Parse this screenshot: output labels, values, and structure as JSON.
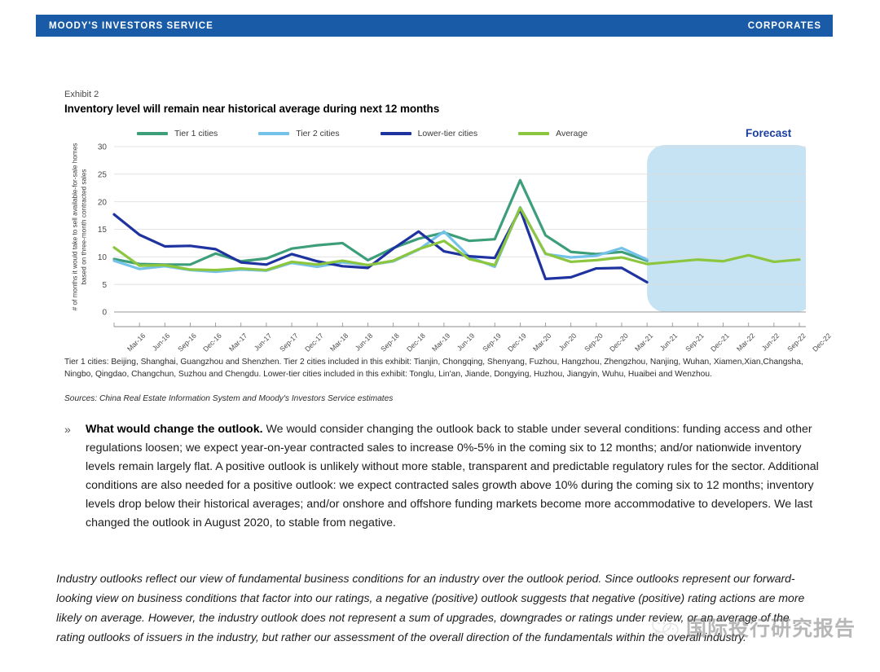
{
  "header": {
    "brand": "MOODY'S INVESTORS SERVICE",
    "sector": "CORPORATES",
    "band_color": "#1a5ba8"
  },
  "exhibit": {
    "label": "Exhibit 2",
    "title": "Inventory level will remain near historical average during next 12 months",
    "forecast_label": "Forecast",
    "footnote": "Tier 1 cities: Beijing, Shanghai, Guangzhou and Shenzhen. Tier 2 cities included in this exhibit: Tianjin, Chongqing, Shenyang, Fuzhou, Hangzhou, Zhengzhou, Nanjing, Wuhan, Xiamen,Xian,Changsha, Ningbo, Qingdao, Changchun, Suzhou and Chengdu. Lower-tier cities included in this exhibit: Tonglu, Lin'an, Jiande, Dongying, Huzhou, Jiangyin, Wuhu, Huaibei and Wenzhou.",
    "sources": "Sources: China Real Estate Information System and Moody's Investors Service estimates"
  },
  "chart_data": {
    "type": "line",
    "title": "Inventory level will remain near historical average during next 12 months",
    "xlabel": "",
    "ylabel": "# of months it would take to sell available-for-sale homes based on three-month contracted sales",
    "ylim": [
      0,
      30
    ],
    "yticks": [
      0,
      5,
      10,
      15,
      20,
      25,
      30
    ],
    "grid": true,
    "legend_position": "top",
    "forecast_band": {
      "from": "Jun-21",
      "to": "Dec-22",
      "color": "#c5e3f2",
      "label": "Forecast"
    },
    "x": [
      "Mar-16",
      "Jun-16",
      "Sep-16",
      "Dec-16",
      "Mar-17",
      "Jun-17",
      "Sep-17",
      "Dec-17",
      "Mar-18",
      "Jun-18",
      "Sep-18",
      "Dec-18",
      "Mar-19",
      "Jun-19",
      "Sep-19",
      "Dec-19",
      "Mar-20",
      "Jun-20",
      "Sep-20",
      "Dec-20",
      "Mar-21",
      "Jun-21",
      "Sep-21",
      "Dec-21",
      "Mar-22",
      "Jun-22",
      "Sep-22",
      "Dec-22"
    ],
    "series": [
      {
        "name": "Tier 1 cities",
        "color": "#3d9e7a",
        "values": [
          9.6,
          8.7,
          8.6,
          8.6,
          10.6,
          9.2,
          9.7,
          11.5,
          12.1,
          12.5,
          9.4,
          11.6,
          13.3,
          14.4,
          12.9,
          13.2,
          23.9,
          13.9,
          10.9,
          10.5,
          10.9,
          9.3,
          null,
          null,
          null,
          null,
          null,
          null
        ]
      },
      {
        "name": "Tier 2 cities",
        "color": "#74c2ea",
        "values": [
          9.3,
          7.8,
          8.3,
          7.6,
          7.3,
          7.7,
          7.5,
          8.9,
          8.2,
          9.0,
          8.5,
          9.2,
          11.3,
          14.6,
          10.0,
          8.2,
          19.0,
          10.5,
          9.9,
          10.2,
          11.6,
          9.5,
          null,
          null,
          null,
          null,
          null,
          null
        ]
      },
      {
        "name": "Lower-tier cities",
        "color": "#1f33a0",
        "values": [
          17.7,
          14.0,
          11.9,
          12.0,
          11.4,
          9.0,
          8.6,
          10.5,
          9.2,
          8.3,
          8.0,
          11.5,
          14.6,
          11.0,
          10.1,
          9.8,
          18.6,
          6.0,
          6.3,
          7.9,
          8.0,
          5.4,
          null,
          null,
          null,
          null,
          null,
          null
        ]
      },
      {
        "name": "Average",
        "color": "#8cc63f",
        "values": [
          11.7,
          8.4,
          8.5,
          7.7,
          7.6,
          7.9,
          7.6,
          9.1,
          8.6,
          9.3,
          8.5,
          9.3,
          11.4,
          12.9,
          9.6,
          8.5,
          18.9,
          10.6,
          9.1,
          9.4,
          9.9,
          8.7,
          9.1,
          9.5,
          9.2,
          10.3,
          9.1,
          9.5
        ]
      }
    ]
  },
  "body": {
    "bullet_mark": "»",
    "lead": "What would change the outlook.",
    "paragraph": " We would consider changing the outlook back to stable under several conditions: funding access and other regulations loosen; we expect year-on-year contracted sales to increase 0%-5% in the coming six to 12 months; and/or nationwide inventory levels remain largely flat. A positive outlook is unlikely without more stable, transparent and predictable regulatory rules for the sector. Additional conditions are also needed for a positive outlook: we expect contracted sales growth above 10% during the coming six to 12 months; inventory levels drop below their historical averages; and/or onshore and offshore funding markets become more accommodative to developers. We last changed the outlook in August 2020, to stable from negative.",
    "closing": "Industry outlooks reflect our view of fundamental business conditions for an industry over the outlook period. Since outlooks represent our forward-looking view on business conditions that factor into our ratings, a negative (positive) outlook suggests that negative (positive) rating actions are more likely on average. However, the industry outlook does not represent a sum of upgrades, downgrades or ratings under review, or an average of the rating outlooks of issuers in the industry, but rather our assessment of the overall direction of the fundamentals within the overall industry."
  },
  "watermark": {
    "text": "国际投行研究报告"
  }
}
